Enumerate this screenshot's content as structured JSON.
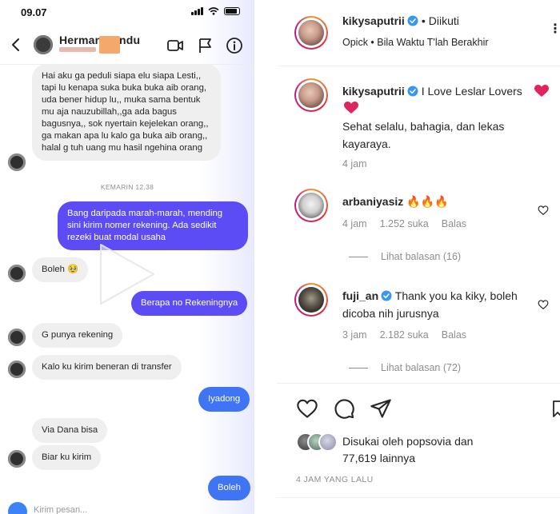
{
  "dm": {
    "status_time": "09.07",
    "contact_name": "Herman Pandu",
    "timestamp_divider": "KEMARIN 12.38",
    "composer_placeholder": "Kirim pesan...",
    "messages": [
      {
        "dir": "in",
        "text": "Hai aku ga peduli siapa elu siapa Lesti,, tapi lu kenapa suka buka buka aib orang, uda bener hidup lu,, muka sama bentuk mu aja nauzubillah,,ga ada bagus bagusnya,, sok nyertain kejelekan orang,, ga makan apa lu kalo ga buka aib orang,, halal g tuh uang mu hasil ngehina orang"
      },
      {
        "dir": "out",
        "text": "Bang daripada marah-marah, mending sini kirim nomer rekening. Ada sedikit rezeki buat modal usaha"
      },
      {
        "dir": "in",
        "text": "Boleh 🥹"
      },
      {
        "dir": "out",
        "text": "Berapa no Rekeningnya"
      },
      {
        "dir": "in",
        "text": "G punya rekening"
      },
      {
        "dir": "in",
        "text": "Kalo ku kirim beneran di transfer"
      },
      {
        "dir": "out",
        "text": "Iyadong"
      },
      {
        "dir": "in",
        "text": "Via Dana bisa"
      },
      {
        "dir": "in",
        "text": "Biar ku kirim"
      },
      {
        "dir": "out",
        "text": "Boleh"
      }
    ]
  },
  "ig": {
    "post_user": "kikysaputrii",
    "follow_status": "Diikuti",
    "music": "Opick • Bila Waktu T'lah Berakhir",
    "caption": {
      "user": "kikysaputrii",
      "line1": "I Love Leslar Lovers",
      "line2": "Sehat selalu, bahagia, dan lekas",
      "line3": "kayaraya.",
      "age": "4 jam"
    },
    "comments": [
      {
        "user": "arbaniyasiz",
        "text": "🔥🔥🔥",
        "age": "4 jam",
        "likes": "1.252 suka",
        "reply": "Balas",
        "view_replies": "Lihat balasan (16)"
      },
      {
        "user": "fuji_an",
        "line1": "Thank you ka kiky, boleh",
        "line2": "dicoba nih jurusnya",
        "age": "3 jam",
        "likes": "2.182 suka",
        "reply": "Balas",
        "view_replies": "Lihat balasan (72)"
      }
    ],
    "likes_line1": "Disukai oleh popsovia dan",
    "likes_line2": "77,619 lainnya",
    "post_age": "4 JAM YANG LALU",
    "colors": {
      "accent_purple": "#5b4cf5",
      "accent_blue": "#3f74f4",
      "verified": "#3897f0",
      "heart": "#ed4956"
    }
  }
}
